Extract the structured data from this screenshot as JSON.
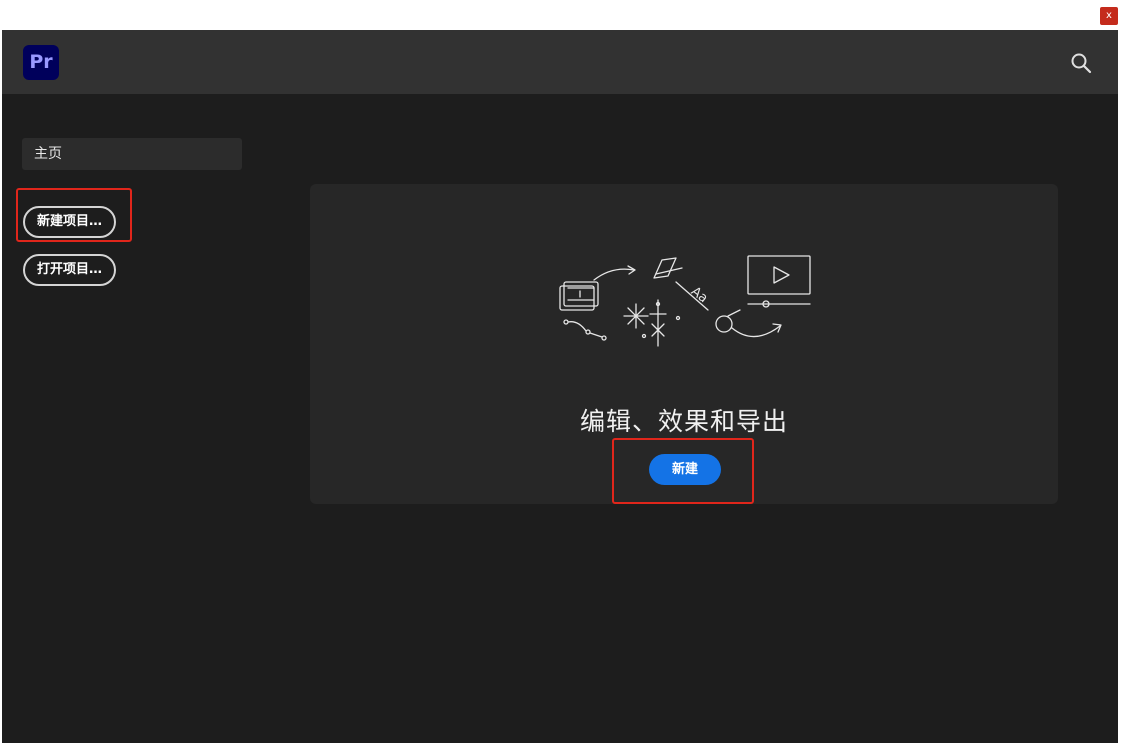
{
  "window": {
    "close_label": "x"
  },
  "header": {
    "logo_text": "Pr",
    "search_icon": "search-icon"
  },
  "sidebar": {
    "home_label": "主页",
    "new_project_label": "新建项目…",
    "open_project_label": "打开项目…"
  },
  "main": {
    "title": "编辑、效果和导出",
    "new_button_label": "新建"
  },
  "colors": {
    "background": "#1d1d1d",
    "header": "#323232",
    "card": "#272727",
    "accent": "#1473e6",
    "logo_bg": "#00005b",
    "logo_text": "#9999ff",
    "highlight": "#e0261b"
  }
}
